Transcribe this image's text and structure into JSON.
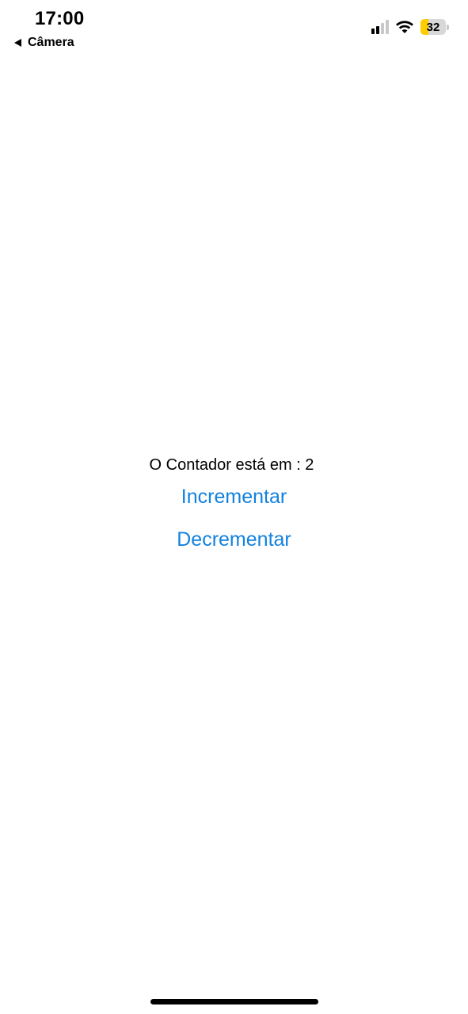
{
  "status_bar": {
    "time": "17:00",
    "back_app_label": "Câmera",
    "signal_icon": "cellular-signal-icon",
    "wifi_icon": "wifi-icon",
    "battery_level": "32",
    "battery_color": "#ffcc00"
  },
  "main": {
    "counter_text": "O Contador está em : 2",
    "increment_label": "Incrementar",
    "decrement_label": "Decrementar",
    "accent_color": "#1282de"
  }
}
